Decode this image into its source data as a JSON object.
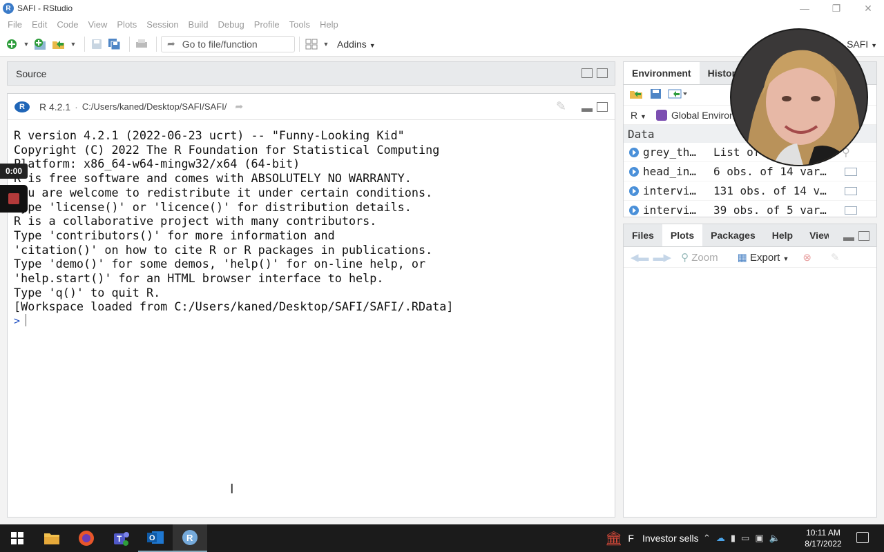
{
  "window": {
    "title": "SAFI - RStudio",
    "logo_letter": "R"
  },
  "menu": [
    "File",
    "Edit",
    "Code",
    "View",
    "Plots",
    "Session",
    "Build",
    "Debug",
    "Profile",
    "Tools",
    "Help"
  ],
  "toolbar": {
    "goto_placeholder": "Go to file/function",
    "addins_label": "Addins",
    "project_label": "SAFI"
  },
  "source": {
    "header_label": "Source"
  },
  "console": {
    "r_version": "R 4.2.1",
    "path": "C:/Users/kaned/Desktop/SAFI/SAFI/",
    "lines": [
      "R version 4.2.1 (2022-06-23 ucrt) -- \"Funny-Looking Kid\"",
      "Copyright (C) 2022 The R Foundation for Statistical Computing",
      "Platform: x86_64-w64-mingw32/x64 (64-bit)",
      "",
      "R is free software and comes with ABSOLUTELY NO WARRANTY.",
      "You are welcome to redistribute it under certain conditions.",
      "Type 'license()' or 'licence()' for distribution details.",
      "",
      "R is a collaborative project with many contributors.",
      "Type 'contributors()' for more information and",
      "'citation()' on how to cite R or R packages in publications.",
      "",
      "Type 'demo()' for some demos, 'help()' for on-line help, or",
      "'help.start()' for an HTML browser interface to help.",
      "Type 'q()' to quit R.",
      "",
      "[Workspace loaded from C:/Users/kaned/Desktop/SAFI/SAFI/.RData]",
      ""
    ],
    "prompt": ">"
  },
  "environment": {
    "tabs": [
      "Environment",
      "History"
    ],
    "language": "R",
    "scope": "Global Environment",
    "section": "Data",
    "rows": [
      {
        "name": "grey_th…",
        "value": "List of 1"
      },
      {
        "name": "head_in…",
        "value": "6 obs. of 14 var…"
      },
      {
        "name": "intervi…",
        "value": "131 obs. of 14 v…"
      },
      {
        "name": "intervi…",
        "value": "39 obs. of 5 var…"
      }
    ]
  },
  "files_pane": {
    "tabs": [
      "Files",
      "Plots",
      "Packages",
      "Help",
      "Viewer"
    ],
    "active_tab": "Plots",
    "zoom_label": "Zoom",
    "export_label": "Export"
  },
  "overlay": {
    "timer": "0:00"
  },
  "taskbar": {
    "news": "Investor sells",
    "news_prefix": "F",
    "time": "10:11 AM",
    "date": "8/17/2022"
  },
  "colors": {
    "accent": "#1f65b7",
    "prompt": "#1f4fc2",
    "taskbar": "#1b1b1b"
  }
}
